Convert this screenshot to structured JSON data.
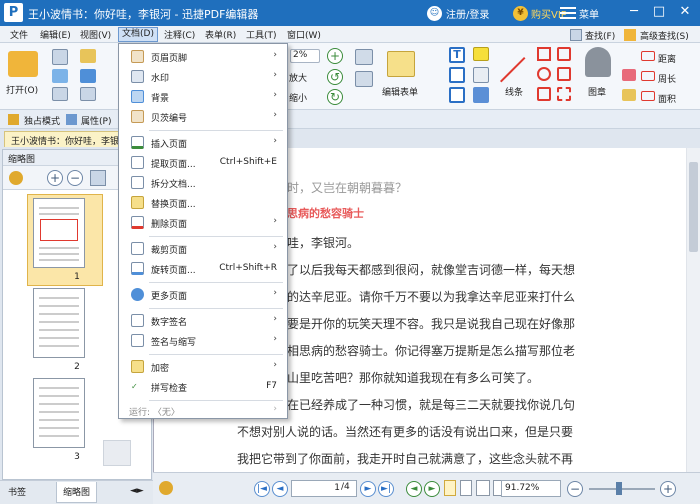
{
  "titlebar": {
    "logo": "P",
    "title": "王小波情书：你好哇，李银河 - 迅捷PDF编辑器",
    "login": "注册/登录",
    "buy": "购买VIP",
    "menu": "菜单",
    "min": "─",
    "max": "□",
    "close": "✕"
  },
  "menubar": {
    "items": [
      "文件",
      "编辑(E)",
      "视图(V)",
      "文档(D)",
      "注释(C)",
      "表单(R)",
      "工具(T)",
      "窗口(W)"
    ]
  },
  "ribbon": {
    "open": "打开(O)",
    "zoom": "2%",
    "enlarge": "放大",
    "shrink": "缩小",
    "edit_form": "编辑表单",
    "line": "线条",
    "stamp": "图章",
    "find": "查找(F)",
    "adv_find": "高级查找(S)",
    "distance": "距离",
    "perimeter": "周长",
    "area": "面积"
  },
  "modebar": {
    "exclusive": "独占模式",
    "props": "属性(P)"
  },
  "doc_tab": "王小波情书：你好哇，李银河",
  "dropdown": {
    "items": [
      {
        "label": "页眉页脚",
        "arrow": "›",
        "shortcut": ""
      },
      {
        "label": "水印",
        "arrow": "›",
        "shortcut": ""
      },
      {
        "label": "背景",
        "arrow": "›",
        "shortcut": ""
      },
      {
        "label": "贝茨编号",
        "arrow": "›",
        "shortcut": ""
      },
      {
        "label": "插入页面",
        "arrow": "›",
        "shortcut": ""
      },
      {
        "label": "提取页面...",
        "arrow": "",
        "shortcut": "Ctrl+Shift+E"
      },
      {
        "label": "拆分文档...",
        "arrow": "",
        "shortcut": ""
      },
      {
        "label": "替换页面...",
        "arrow": "",
        "shortcut": ""
      },
      {
        "label": "删除页面",
        "arrow": "›",
        "shortcut": ""
      },
      {
        "label": "裁剪页面",
        "arrow": "›",
        "shortcut": ""
      },
      {
        "label": "旋转页面...",
        "arrow": "",
        "shortcut": "Ctrl+Shift+R"
      },
      {
        "label": "更多页面",
        "arrow": "›",
        "shortcut": ""
      },
      {
        "label": "数字签名",
        "arrow": "›",
        "shortcut": ""
      },
      {
        "label": "签名与缩写",
        "arrow": "›",
        "shortcut": ""
      },
      {
        "label": "加密",
        "arrow": "›",
        "shortcut": ""
      },
      {
        "label": "拼写检查",
        "arrow": "",
        "shortcut": "F7"
      },
      {
        "label": "运行: 〈无〉",
        "arrow": "›",
        "shortcut": ""
      }
    ]
  },
  "thumbnails": {
    "title": "缩略图",
    "pages": [
      "1",
      "2",
      "3"
    ]
  },
  "bottom_tabs": [
    "书签",
    "缩略图"
  ],
  "doc_lines": [
    "时，又岂在朝朝暮暮？",
    "思病的愁容骑士",
    "哇，李银河。",
    "了以后我每天都感到很闷，就像堂吉诃德一样，每天想",
    "的达辛尼亚。请你千万不要以为我拿达辛尼亚来打什么",
    "要是开你的玩笑天理不容。我只是说我自己现在好像那",
    "相思病的愁容骑士。你记得塞万提斯是怎么描写那位老",
    "山里吃苦吧？那你就知道我现在有多么可笑了。",
    "在已经养成了一种习惯，就是每三二天就要找你说几句",
    "不想对别人说的话。当然还有更多的话没有说出口来，但是只要",
    "我把它带到了你面前，我走开时自己就满意了，这些念头就不再"
  ],
  "status": {
    "page": "1",
    "total": "/4",
    "zoom": "91.72%"
  },
  "colors": {
    "title_bg": "#1f6fbd",
    "accent_red": "#e05050",
    "heading_color": "#e85b5b"
  }
}
